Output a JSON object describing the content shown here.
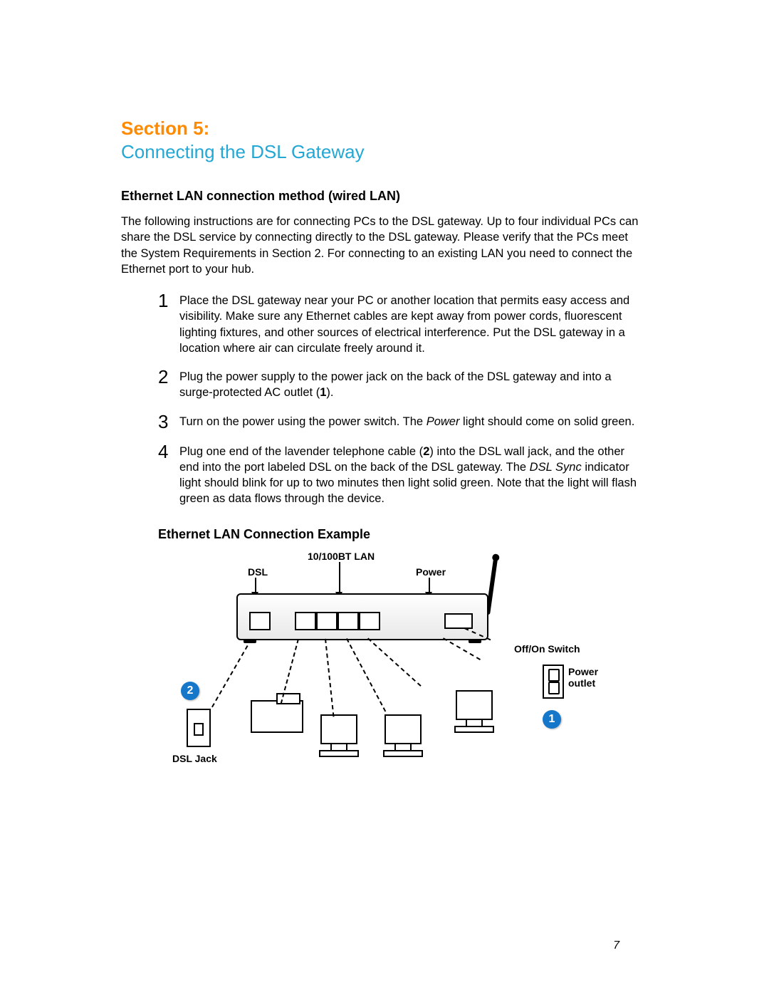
{
  "section_label": "Section 5:",
  "section_title": "Connecting the DSL Gateway",
  "heading1": "Ethernet LAN connection method (wired LAN)",
  "intro": "The following instructions are for connecting PCs to the DSL gateway. Up to four individual PCs can share the DSL service by connecting directly to the DSL gateway. Please verify that the PCs meet the System Requirements in Section 2. For connecting to an existing LAN you need to connect the Ethernet port to your hub.",
  "steps": [
    {
      "n": "1",
      "text": "Place the DSL gateway near your PC or another location that permits easy access and visibility. Make sure any Ethernet cables are kept away from power cords, fluorescent lighting fixtures, and other sources of electrical interference. Put the DSL gateway in a location where air can circulate freely around it."
    },
    {
      "n": "2",
      "text_html": "Plug the power supply to the power jack on the back of the DSL gateway and into a surge-protected AC outlet (<b>1</b>)."
    },
    {
      "n": "3",
      "text_html": "Turn on the power using the power switch. The <i>Power</i> light should come on solid green."
    },
    {
      "n": "4",
      "text_html": "Plug one end of the lavender telephone cable (<b>2</b>) into the DSL wall jack, and the other end into the port labeled DSL on the back of the DSL gateway. The <i>DSL Sync</i> indicator light should blink for up to two minutes then light solid green. Note that the light will flash green as data flows through the device."
    }
  ],
  "heading2": "Ethernet LAN Connection Example",
  "diagram": {
    "labels": {
      "lan": "10/100BT LAN",
      "dsl": "DSL",
      "power": "Power",
      "switch": "Off/On Switch",
      "outlet": "Power\noutlet",
      "dsljack": "DSL Jack"
    },
    "callouts": {
      "one": "1",
      "two": "2"
    }
  },
  "page_number": "7"
}
